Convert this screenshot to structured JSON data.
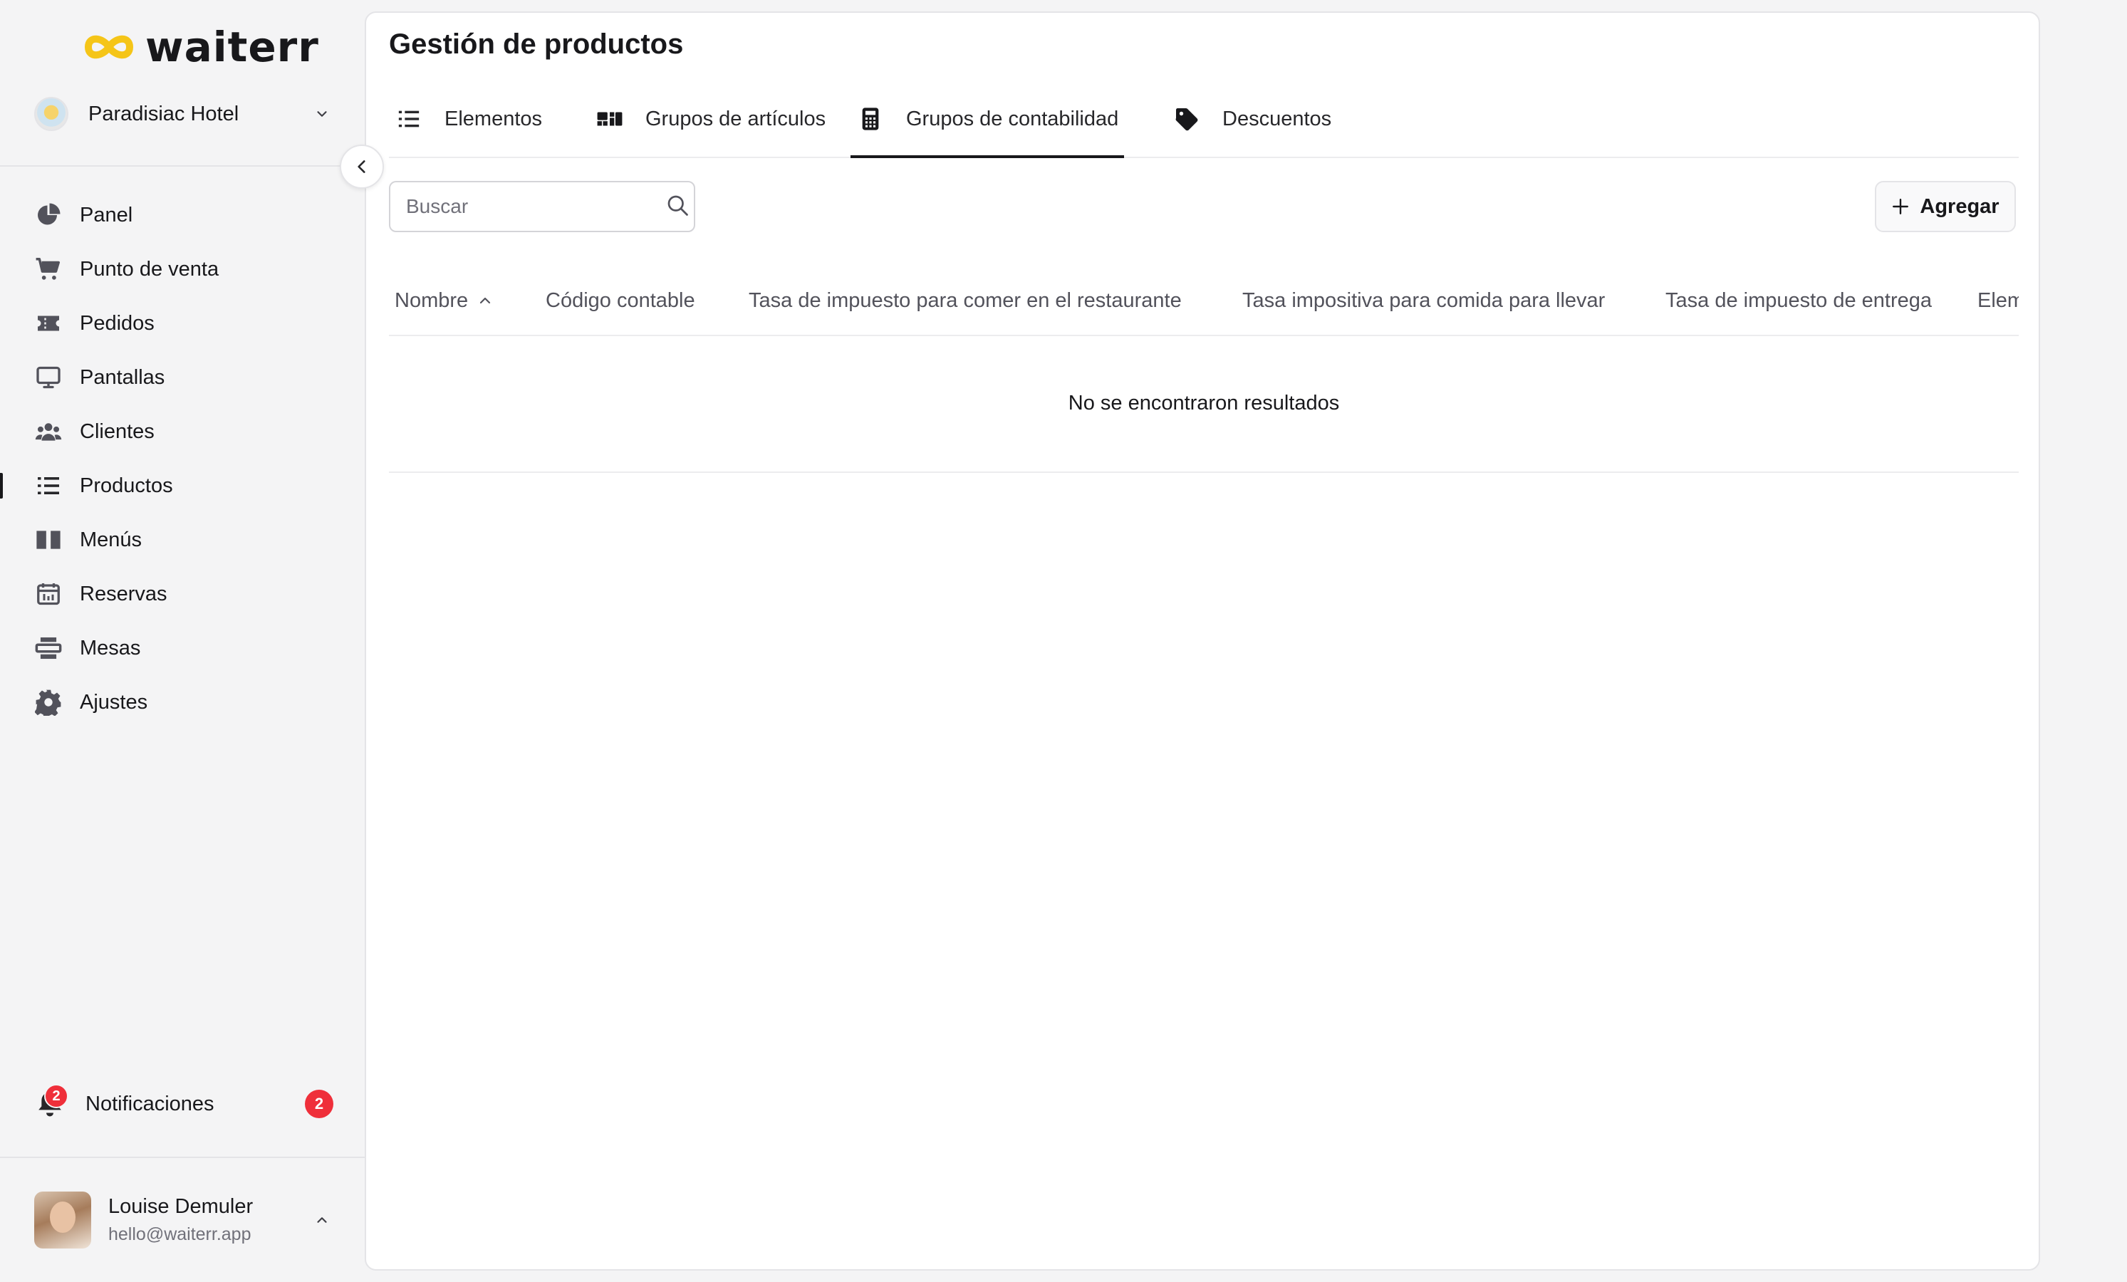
{
  "app": {
    "brand": "waiterr",
    "accent_color": "#f5c518",
    "danger_color": "#ef2f3a"
  },
  "sidebar": {
    "venue": {
      "name": "Paradisiac Hotel",
      "icon": "hotel-avatar"
    },
    "collapse_icon": "chevron-left-icon",
    "items": [
      {
        "label": "Panel",
        "icon": "pie-chart-icon",
        "active": false
      },
      {
        "label": "Punto de venta",
        "icon": "cart-icon",
        "active": false
      },
      {
        "label": "Pedidos",
        "icon": "ticket-icon",
        "active": false
      },
      {
        "label": "Pantallas",
        "icon": "monitor-icon",
        "active": false
      },
      {
        "label": "Clientes",
        "icon": "users-icon",
        "active": false
      },
      {
        "label": "Productos",
        "icon": "list-icon",
        "active": true
      },
      {
        "label": "Menús",
        "icon": "book-icon",
        "active": false
      },
      {
        "label": "Reservas",
        "icon": "calendar-icon",
        "active": false
      },
      {
        "label": "Mesas",
        "icon": "table-icon",
        "active": false
      },
      {
        "label": "Ajustes",
        "icon": "gear-icon",
        "active": false
      }
    ],
    "notifications": {
      "label": "Notificaciones",
      "count": "2",
      "icon": "bell-icon"
    },
    "user": {
      "name": "Louise Demuler",
      "email": "hello@waiterr.app"
    }
  },
  "main": {
    "title": "Gestión de productos",
    "tabs": [
      {
        "label": "Elementos",
        "icon": "list-icon",
        "active": false
      },
      {
        "label": "Grupos de artículos",
        "icon": "group-icon",
        "active": false
      },
      {
        "label": "Grupos de contabilidad",
        "icon": "calculator-icon",
        "active": true
      },
      {
        "label": "Descuentos",
        "icon": "tag-icon",
        "active": false
      }
    ],
    "search": {
      "placeholder": "Buscar",
      "value": ""
    },
    "add_button": "Agregar",
    "table": {
      "columns": [
        "Nombre",
        "Código contable",
        "Tasa de impuesto para comer en el restaurante",
        "Tasa impositiva para comida para llevar",
        "Tasa de impuesto de entrega",
        "Elementos"
      ],
      "sort": {
        "column": "Nombre",
        "direction": "asc"
      },
      "empty_message": "No se encontraron resultados"
    }
  }
}
